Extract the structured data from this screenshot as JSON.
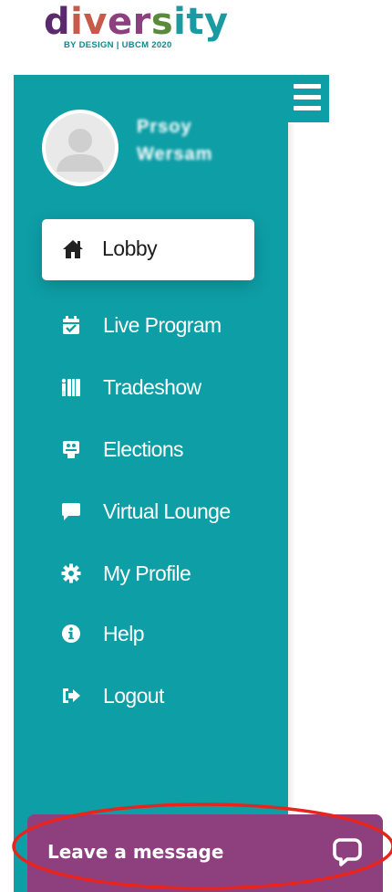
{
  "logo": {
    "letters": [
      {
        "ch": "d",
        "color": "#5b2a6e"
      },
      {
        "ch": "i",
        "color": "#c85a4b"
      },
      {
        "ch": "v",
        "color": "#c85a4b"
      },
      {
        "ch": "e",
        "color": "#8e3f7e"
      },
      {
        "ch": "r",
        "color": "#8e3f7e"
      },
      {
        "ch": "s",
        "color": "#5a8a3c"
      },
      {
        "ch": "i",
        "color": "#1a9aa3"
      },
      {
        "ch": "t",
        "color": "#1a9aa3"
      },
      {
        "ch": "y",
        "color": "#1a9aa3"
      }
    ],
    "subtitle": "BY DESIGN | UBCM 2020"
  },
  "user": {
    "name_line1": "Prsoy",
    "name_line2": "Wersam",
    "avatar": "person-silhouette-icon"
  },
  "nav": {
    "active": {
      "label": "Lobby",
      "icon": "home-icon"
    },
    "items": [
      {
        "label": "Live Program",
        "icon": "calendar-check-icon"
      },
      {
        "label": "Tradeshow",
        "icon": "tradeshow-icon"
      },
      {
        "label": "Elections",
        "icon": "ballot-box-icon"
      },
      {
        "label": "Virtual Lounge",
        "icon": "chat-bubble-icon"
      },
      {
        "label": "My Profile",
        "icon": "gear-icon"
      },
      {
        "label": "Help",
        "icon": "info-circle-icon"
      },
      {
        "label": "Logout",
        "icon": "sign-out-icon"
      }
    ]
  },
  "chat": {
    "label": "Leave a message",
    "icon": "speech-bubble-icon"
  },
  "colors": {
    "sidebar": "#0e9ea6",
    "chat": "#8e3f7e",
    "highlight": "#e8241c"
  }
}
